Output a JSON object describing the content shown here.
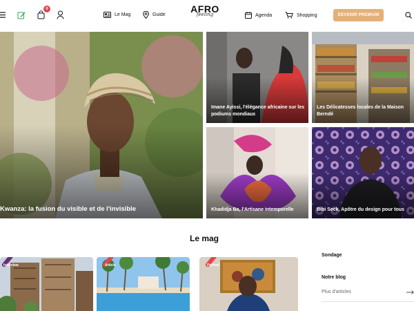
{
  "header": {
    "cart_count": "0",
    "nav_le_mag": "Le Mag",
    "nav_guide": "Guide",
    "logo_word": "AFRO",
    "logo_script": "feeling",
    "nav_agenda": "Agenda",
    "nav_shopping": "Shopping",
    "premium_label": "DEVENIR PREMIUM"
  },
  "hero": {
    "main_title": "Kwanza: la fusion du visible et de l'invisible",
    "cards": [
      {
        "title": "Imane Ayissi, l'élégance africaine sur les podiums mondiaux"
      },
      {
        "title": "Les Délicatesses locales de la Maison Berndé"
      },
      {
        "title": "Khadidja Ba, l'Artisane intemporelle"
      },
      {
        "title": "Bibi Seck, Apôtre du design pour tous"
      }
    ]
  },
  "mag": {
    "section_title": "Le mag",
    "articles": [
      {
        "tag": "Interview"
      },
      {
        "tag": "Article"
      },
      {
        "tag": "Portrait"
      }
    ]
  },
  "sidebar": {
    "sondage": "Sondage",
    "notre_blog": "Notre blog",
    "plus_articles": "Plus d'articles"
  },
  "colors": {
    "accent_premium": "#e4b078",
    "badge_red": "#e0474c",
    "stroke_purple": "#6b2b7b",
    "stroke_red": "#e0474c"
  },
  "icons": [
    "menu-icon",
    "edit-icon",
    "bag-icon",
    "user-icon",
    "magazine-icon",
    "location-icon",
    "calendar-icon",
    "cart-icon",
    "search-icon",
    "arrow-right-icon"
  ]
}
